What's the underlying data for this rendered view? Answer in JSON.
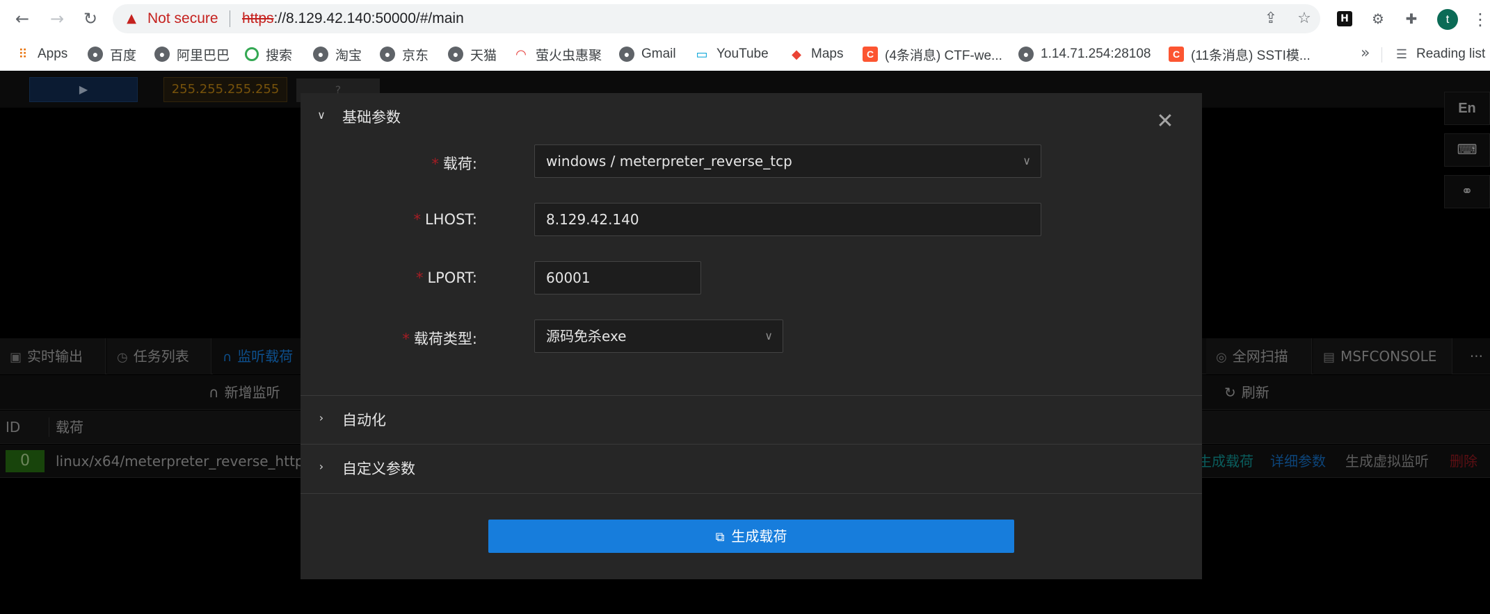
{
  "browser": {
    "security_text": "Not secure",
    "url_scheme": "https",
    "url_rest": "://8.129.42.140:50000/#/main",
    "avatar_letter": "t"
  },
  "bookmarks": [
    {
      "label": "Apps",
      "icon": "apps-grid-icon"
    },
    {
      "label": "百度",
      "icon": "globe-icon"
    },
    {
      "label": "阿里巴巴",
      "icon": "globe-icon"
    },
    {
      "label": "搜索",
      "icon": "search-ring-icon"
    },
    {
      "label": "淘宝",
      "icon": "globe-icon"
    },
    {
      "label": "京东",
      "icon": "globe-icon"
    },
    {
      "label": "天猫",
      "icon": "globe-icon"
    },
    {
      "label": "萤火虫惠聚",
      "icon": "firefly-icon"
    },
    {
      "label": "Gmail",
      "icon": "globe-icon"
    },
    {
      "label": "YouTube",
      "icon": "tv-icon"
    },
    {
      "label": "Maps",
      "icon": "maps-icon"
    },
    {
      "label": "(4条消息) CTF-we...",
      "icon": "csdn-icon"
    },
    {
      "label": "1.14.71.254:28108",
      "icon": "globe-icon"
    },
    {
      "label": "(11条消息) SSTI模...",
      "icon": "csdn-icon"
    }
  ],
  "bookmarks_more": "»",
  "reading_list": "Reading list",
  "app": {
    "ip_tag": "255.255.255.255",
    "q_tag": "?",
    "lang_button": "En",
    "tabs": [
      {
        "label": "实时输出"
      },
      {
        "label": "任务列表"
      },
      {
        "label": "监听载荷"
      },
      {
        "label": "全网扫描"
      },
      {
        "label": "MSFCONSOLE"
      }
    ],
    "tabs_more": "···",
    "add_listener": "新增监听",
    "refresh": "刷新",
    "table": {
      "columns": [
        "ID",
        "载荷"
      ],
      "rows": [
        {
          "id": "0",
          "payload": "linux/x64/meterpreter_reverse_http",
          "actions": [
            "生成载荷",
            "详细参数",
            "生成虚拟监听",
            "删除"
          ]
        }
      ]
    }
  },
  "modal": {
    "section_basic": "基础参数",
    "section_auto": "自动化",
    "section_custom": "自定义参数",
    "fields": {
      "payload": {
        "label": "载荷:",
        "value": "windows / meterpreter_reverse_tcp"
      },
      "lhost": {
        "label": "LHOST:",
        "value": "8.129.42.140"
      },
      "lport": {
        "label": "LPORT:",
        "value": "60001"
      },
      "payload_type": {
        "label": "载荷类型:",
        "value": "源码免杀exe"
      }
    },
    "generate_button": "生成载荷"
  },
  "colors": {
    "primary": "#177ddc",
    "danger": "#a61d24",
    "warning_tag": "#d89614",
    "success_tag": "#2d7d14"
  }
}
